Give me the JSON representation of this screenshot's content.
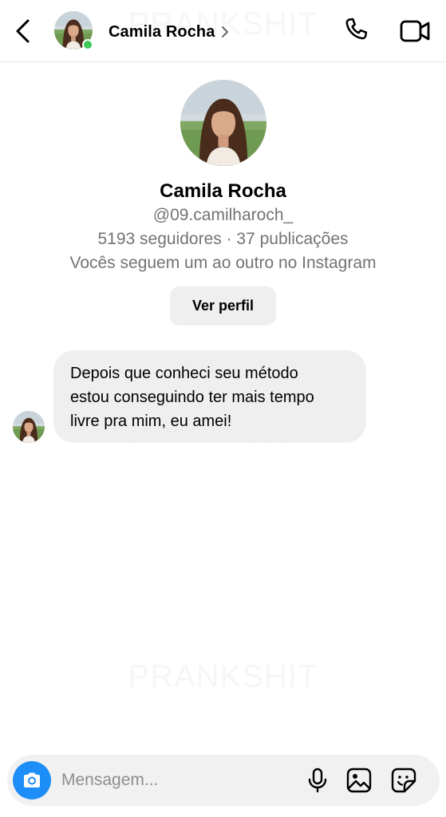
{
  "header": {
    "contact_name": "Camila Rocha",
    "online": true
  },
  "watermark": {
    "text": "PRANKSHIT"
  },
  "profile": {
    "name": "Camila Rocha",
    "handle": "@09.camilharoch_",
    "stats": "5193 seguidores · 37 publicações",
    "mutual": "Vocês seguem um ao outro no Instagram",
    "view_profile_label": "Ver perfil"
  },
  "messages": [
    {
      "sender": "Camila Rocha",
      "lines": [
        "Depois que conheci seu método",
        "estou conseguindo ter mais tempo",
        "livre pra mim, eu amei!"
      ]
    }
  ],
  "composer": {
    "placeholder": "Mensagem...",
    "value": ""
  },
  "icons": {
    "back": "chevron-left-icon",
    "call": "phone-icon",
    "video": "video-camera-icon",
    "camera": "camera-icon",
    "mic": "microphone-icon",
    "gallery": "image-icon",
    "sticker": "sticker-icon"
  },
  "colors": {
    "accent": "#1d8ef7",
    "online": "#3ec95a",
    "secondary_text": "#737373",
    "bubble": "#efefef"
  }
}
